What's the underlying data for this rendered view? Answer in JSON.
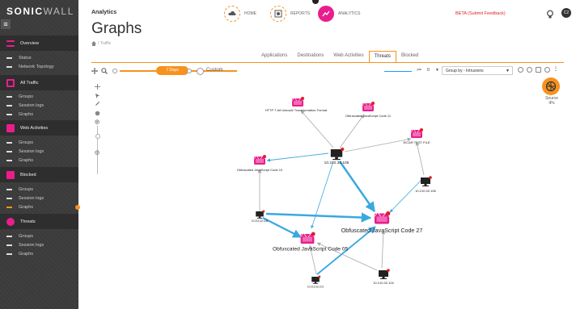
{
  "brand": {
    "name": "SONIC",
    "suffix": "WALL"
  },
  "sidebar": {
    "sections": [
      {
        "label": "Overview",
        "items": [
          "Status",
          "Network Topology"
        ]
      },
      {
        "label": "All Traffic",
        "items": [
          "Groups",
          "Session logs",
          "Graphs"
        ]
      },
      {
        "label": "Web Activities",
        "items": [
          "Groups",
          "Session logs",
          "Graphs"
        ]
      },
      {
        "label": "Blocked",
        "items": [
          "Groups",
          "Session logs",
          "Graphs"
        ]
      },
      {
        "label": "Threats",
        "items": [
          "Groups",
          "Session logs",
          "Graphs"
        ]
      }
    ]
  },
  "header": {
    "title": "Analytics",
    "nav": [
      {
        "label": "HOME"
      },
      {
        "label": "REPORTS"
      },
      {
        "label": "ANALYTICS"
      }
    ],
    "beta": "BETA (Submit Feedback)",
    "user_initials": "C2"
  },
  "page": {
    "title": "Graphs",
    "breadcrumb": "/ Traffic"
  },
  "tabs": [
    "Applications",
    "Destinations",
    "Web Activities",
    "Threats",
    "Blocked"
  ],
  "active_tab": "Threats",
  "toolbar": {
    "time_label": "7 Days",
    "custom_label": "Custom",
    "filter_op": ">=",
    "filter_value": "0",
    "group_by": "Group by - Intrusions"
  },
  "source_button": {
    "label": "Source IPs"
  },
  "graph": {
    "nodes": [
      {
        "id": "h1",
        "type": "host",
        "label": "10.210.32.105"
      },
      {
        "id": "h2",
        "type": "host",
        "label": "10.210.32.106"
      },
      {
        "id": "h3",
        "type": "host",
        "label": "10.210.32.108"
      },
      {
        "id": "h4",
        "type": "host",
        "label": "10.210.32.104"
      },
      {
        "id": "h5",
        "type": "host",
        "label": "10.210.32.101"
      },
      {
        "id": "t1",
        "type": "threat",
        "label": "HTTP 7-bit Unicode Transformation Format"
      },
      {
        "id": "t2",
        "type": "threat",
        "label": "Obfuscated JavaScript Code 11"
      },
      {
        "id": "t3",
        "type": "threat",
        "label": "EICAR TEST FILE"
      },
      {
        "id": "t4",
        "type": "threat",
        "label": "Obfuscated JavaScript Code 10"
      },
      {
        "id": "t5",
        "type": "threat",
        "label": "Obfuscated JavaScript Code 27"
      },
      {
        "id": "t6",
        "type": "threat",
        "label": "Obfuscated JavaScript Code 05"
      }
    ]
  },
  "colors": {
    "accent": "#f7921e",
    "brand_pink": "#e91e8c",
    "sidebar": "#3b3b3b",
    "edge_blue": "#3aa8e0",
    "edge_gray": "#aaaaaa"
  }
}
